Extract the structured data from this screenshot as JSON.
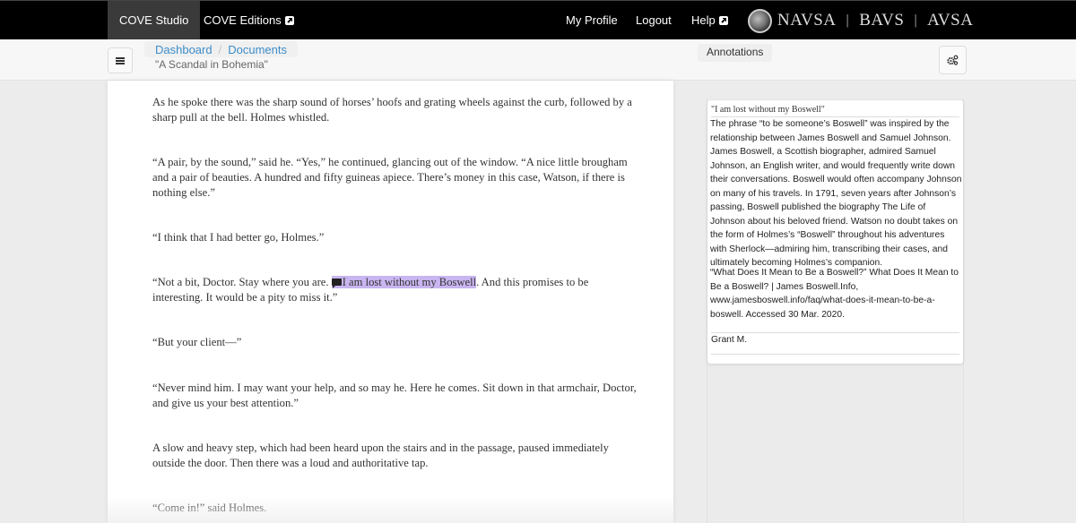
{
  "navbar": {
    "items_left": [
      {
        "label": "COVE Studio",
        "active": true
      },
      {
        "label": "COVE Editions",
        "external": true
      }
    ],
    "items_right": [
      {
        "label": "My Profile"
      },
      {
        "label": "Logout"
      },
      {
        "label": "Help",
        "external": true
      }
    ],
    "brand": {
      "org1": "NAVSA",
      "separator": "|",
      "org2": "BAVS",
      "org3": "AVSA",
      "logo_icon": "society-seal-icon"
    }
  },
  "subheader": {
    "breadcrumb": [
      "Dashboard",
      "Documents"
    ],
    "breadcrumb_separator": "/",
    "document_title": "\"A Scandal in Bohemia\"",
    "annotations_tab": "Annotations",
    "menu_icon": "hamburger-icon",
    "settings_icon": "gears-icon"
  },
  "document": {
    "paragraphs": [
      "As he spoke there was the sharp sound of horses’ hoofs and grating wheels against the curb, followed by a sharp pull at the bell. Holmes whistled.",
      "“A pair, by the sound,” said he. “Yes,” he continued, glancing out of the window. “A nice little brougham and a pair of beauties. A hundred and fifty guineas apiece. There’s money in this case, Watson, if there is nothing else.”",
      "“I think that I had better go, Holmes.”",
      {
        "before": "“Not a bit, Doctor. Stay where you are. ",
        "highlight": "I am lost without my Boswell",
        "after": ". And this promises to be interesting. It would be a pity to miss it.”"
      },
      "“But your client—”",
      "“Never mind him. I may want your help, and so may he. Here he comes. Sit down in that armchair, Doctor, and give us your best attention.”",
      "A slow and heavy step, which had been heard upon the stairs and in the passage, paused immediately outside the door. Then there was a loud and authoritative tap.",
      "“Come in!” said Holmes."
    ],
    "highlight_color": "#c9b5f0"
  },
  "annotation": {
    "quote": "\"I am lost without my Boswell\"",
    "body": "The phrase “to be someone’s Boswell” was inspired by the relationship between James Boswell and Samuel Johnson. James Boswell, a Scottish biographer, admired Samuel Johnson, an English writer, and would frequently write down their conversations. Boswell would often accompany Johnson on many of his travels. In 1791, seven years after Johnson’s passing, Boswell published the biography The Life of Johnson about his beloved friend. Watson no doubt takes on the form of Holmes’s “Boswell” throughout his adventures with Sherlock—admiring him, transcribing their cases, and ultimately becoming Holmes’s companion.",
    "citation": "“What Does It Mean to Be a Boswell?” What Does It Mean to Be a Boswell? | James Boswell.Info, www.jamesboswell.info/faq/what-does-it-mean-to-be-a-boswell. Accessed 30 Mar. 2020.",
    "author": "Grant M."
  }
}
